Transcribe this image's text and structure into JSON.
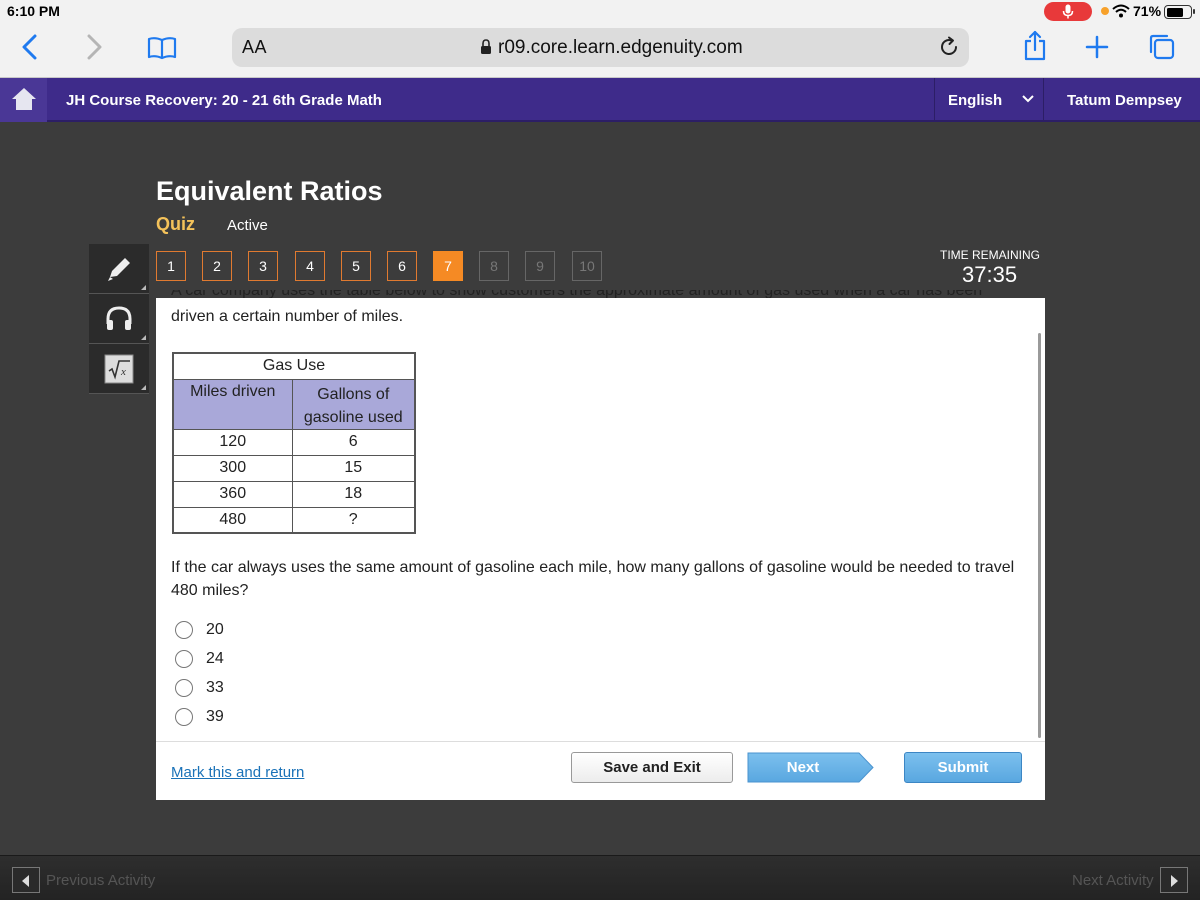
{
  "status": {
    "time": "6:10 PM",
    "battery": "71%"
  },
  "browser": {
    "text_size_label": "AA",
    "url": "r09.core.learn.edgenuity.com"
  },
  "course": {
    "title": "JH Course Recovery: 20 - 21 6th Grade Math",
    "language": "English",
    "user": "Tatum Dempsey"
  },
  "activity": {
    "title": "Equivalent Ratios",
    "type": "Quiz",
    "status": "Active"
  },
  "question_tabs": [
    {
      "label": "1",
      "state": "answered"
    },
    {
      "label": "2",
      "state": "answered"
    },
    {
      "label": "3",
      "state": "answered"
    },
    {
      "label": "4",
      "state": "answered"
    },
    {
      "label": "5",
      "state": "answered"
    },
    {
      "label": "6",
      "state": "answered"
    },
    {
      "label": "7",
      "state": "current"
    },
    {
      "label": "8",
      "state": "disabled"
    },
    {
      "label": "9",
      "state": "disabled"
    },
    {
      "label": "10",
      "state": "disabled"
    }
  ],
  "timer": {
    "label": "TIME REMAINING",
    "value": "37:35"
  },
  "colors": {
    "course_header": "#3e2b8a",
    "tab_accent": "#f58a24",
    "next_button": "#5aa9e2",
    "quiz_label": "#f4c25a",
    "table_header": "#a9a8d9"
  },
  "question": {
    "intro_cut": "A car company uses the table below to show customers the approximate amount of gas used when a car has been",
    "intro": "driven a certain number of miles.",
    "table": {
      "caption": "Gas Use",
      "headers": [
        "Miles driven",
        "Gallons of gasoline used"
      ],
      "rows": [
        [
          "120",
          "6"
        ],
        [
          "300",
          "15"
        ],
        [
          "360",
          "18"
        ],
        [
          "480",
          "?"
        ]
      ]
    },
    "prompt": "If the car always uses the same amount of gasoline each mile, how many gallons of gasoline would be needed to travel 480 miles?",
    "choices": [
      "20",
      "24",
      "33",
      "39"
    ]
  },
  "footer": {
    "mark_link": "Mark this and return",
    "save_exit": "Save and Exit",
    "next": "Next",
    "submit": "Submit"
  },
  "bottom_nav": {
    "previous": "Previous Activity",
    "next": "Next Activity"
  },
  "tools": [
    "pencil-icon",
    "headphones-icon",
    "calculator-icon"
  ]
}
